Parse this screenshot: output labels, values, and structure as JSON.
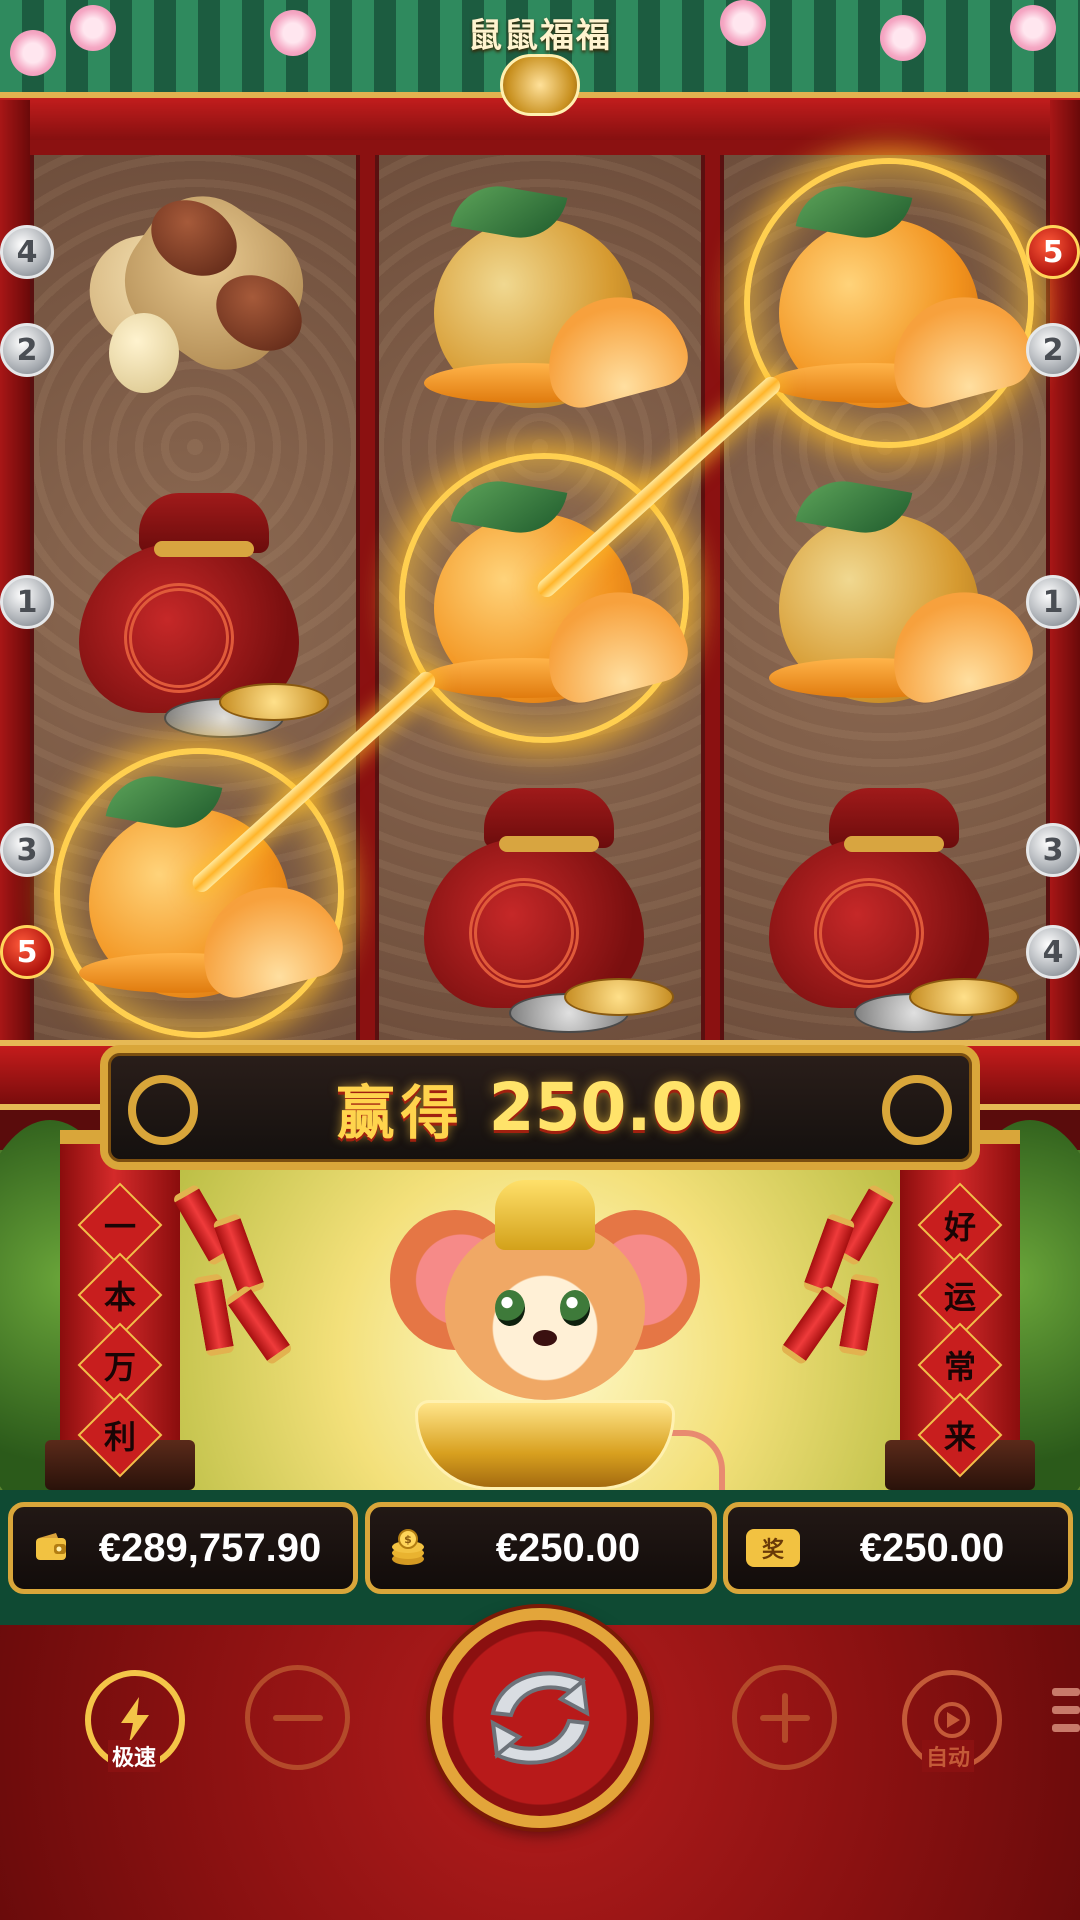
{
  "game": {
    "title": "鼠鼠福福"
  },
  "reels": [
    {
      "symbols": [
        "peanut",
        "money-bag",
        "orange"
      ],
      "highlighted": [
        false,
        false,
        true
      ]
    },
    {
      "symbols": [
        "orange",
        "orange",
        "money-bag"
      ],
      "highlighted": [
        false,
        true,
        false
      ]
    },
    {
      "symbols": [
        "orange",
        "orange",
        "money-bag"
      ],
      "highlighted": [
        true,
        false,
        false
      ]
    }
  ],
  "paylines": {
    "left": [
      "4",
      "2",
      "1",
      "3",
      "5"
    ],
    "right": [
      "5",
      "2",
      "1",
      "3",
      "4"
    ],
    "active_line": "5"
  },
  "win": {
    "label": "赢得",
    "amount": "250.00"
  },
  "couplets": {
    "left": [
      "一",
      "本",
      "万",
      "利"
    ],
    "right": [
      "好",
      "运",
      "常",
      "来"
    ]
  },
  "balance_bar": {
    "balance": "€289,757.90",
    "bet": "€250.00",
    "win": "€250.00",
    "balance_icon": "wallet-icon",
    "bet_icon": "coins-icon",
    "win_icon": "prize-icon",
    "win_icon_text": "奖"
  },
  "controls": {
    "turbo_label": "极速",
    "auto_label": "自动"
  },
  "colors": {
    "gold": "#d9a63a",
    "win_text": "#ffe36a",
    "active_line": "#b0150e",
    "panel_red": "#8a1111"
  }
}
